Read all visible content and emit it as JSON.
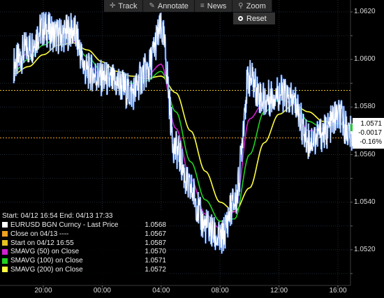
{
  "toolbar": {
    "track": {
      "label": "Track",
      "icon": "crosshair-icon"
    },
    "annotate": {
      "label": "Annotate",
      "icon": "pencil-icon"
    },
    "news": {
      "label": "News",
      "icon": "list-icon"
    },
    "zoom": {
      "label": "Zoom",
      "icon": "magnifier-icon"
    },
    "reset": {
      "label": "Reset",
      "icon": "radio-dot-icon"
    }
  },
  "last_value_tag": {
    "price": "1.0571",
    "change": "-0.0017",
    "percent": "-0.16%"
  },
  "legend": {
    "header": "Start: 04/12 16:54 End: 04/13 17:33",
    "rows": [
      {
        "label": "EURUSD BGN Curncy - Last Price",
        "value": "1.0568",
        "color": "#ffffff"
      },
      {
        "label": "Close on 04/13 ----",
        "value": "1.0567",
        "color": "#f0a020"
      },
      {
        "label": "Start on 04/12 16:55",
        "value": "1.0587",
        "color": "#e8c020"
      },
      {
        "label": "SMAVG (50) on Close",
        "value": "1.0570",
        "color": "#d020d0"
      },
      {
        "label": "SMAVG (100) on Close",
        "value": "1.0571",
        "color": "#20d020"
      },
      {
        "label": "SMAVG (200) on Close",
        "value": "1.0572",
        "color": "#ffff40"
      }
    ]
  },
  "chart_data": {
    "type": "line",
    "title": "",
    "xlabel": "",
    "ylabel": "",
    "ylim": [
      1.0505,
      1.0625
    ],
    "x_ticks": [
      "20:00",
      "00:00",
      "04:00",
      "08:00",
      "12:00",
      "16:00"
    ],
    "y_ticks": [
      "1.0520",
      "1.0540",
      "1.0560",
      "1.0580",
      "1.0600",
      "1.0620"
    ],
    "grid": true,
    "legend_position": "bottom-left",
    "colors": {
      "price": "#ffffff",
      "price_glow": "#4a8cff",
      "sma50": "#d020d0",
      "sma100": "#20d020",
      "sma200": "#ffff40",
      "start_line": "#e8c020",
      "close_line": "#f0a020",
      "grid": "#1e2a38"
    },
    "x": [
      "18:00",
      "19:00",
      "20:00",
      "21:00",
      "22:00",
      "23:00",
      "00:00",
      "01:00",
      "02:00",
      "03:00",
      "04:00",
      "05:00",
      "06:00",
      "07:00",
      "08:00",
      "09:00",
      "10:00",
      "11:00",
      "12:00",
      "13:00",
      "14:00",
      "15:00",
      "16:00",
      "17:00"
    ],
    "series": [
      {
        "name": "EURUSD BGN Curncy - Last Price",
        "values": [
          1.0598,
          1.0605,
          1.0613,
          1.061,
          1.0612,
          1.0595,
          1.0592,
          1.059,
          1.0586,
          1.0595,
          1.0612,
          1.0562,
          1.0545,
          1.053,
          1.0524,
          1.054,
          1.0592,
          1.0583,
          1.0586,
          1.0582,
          1.0566,
          1.0569,
          1.0576,
          1.0568
        ]
      },
      {
        "name": "SMAVG (50) on Close",
        "values": [
          1.0596,
          1.0603,
          1.0609,
          1.0611,
          1.0608,
          1.0598,
          1.0593,
          1.0591,
          1.0589,
          1.0593,
          1.0598,
          1.0571,
          1.055,
          1.0535,
          1.0529,
          1.0536,
          1.0575,
          1.0582,
          1.0584,
          1.0581,
          1.057,
          1.0571,
          1.0574,
          1.057
        ]
      },
      {
        "name": "SMAVG (100) on Close",
        "values": [
          1.0595,
          1.06,
          1.0606,
          1.061,
          1.0608,
          1.0601,
          1.0595,
          1.0592,
          1.059,
          1.0591,
          1.0595,
          1.0578,
          1.0557,
          1.0541,
          1.0532,
          1.0533,
          1.056,
          1.0578,
          1.0583,
          1.0582,
          1.0574,
          1.0571,
          1.0573,
          1.0571
        ]
      },
      {
        "name": "SMAVG (200) on Close",
        "values": [
          1.0594,
          1.0597,
          1.0602,
          1.0606,
          1.0607,
          1.0604,
          1.0599,
          1.0595,
          1.0593,
          1.0592,
          1.0593,
          1.0586,
          1.057,
          1.0553,
          1.054,
          1.0536,
          1.0546,
          1.0565,
          1.0577,
          1.0581,
          1.0578,
          1.0574,
          1.0573,
          1.0572
        ]
      }
    ],
    "reference_lines": [
      {
        "name": "Start on 04/12 16:55",
        "value": 1.0587
      },
      {
        "name": "Close on 04/13",
        "value": 1.0567
      }
    ]
  }
}
